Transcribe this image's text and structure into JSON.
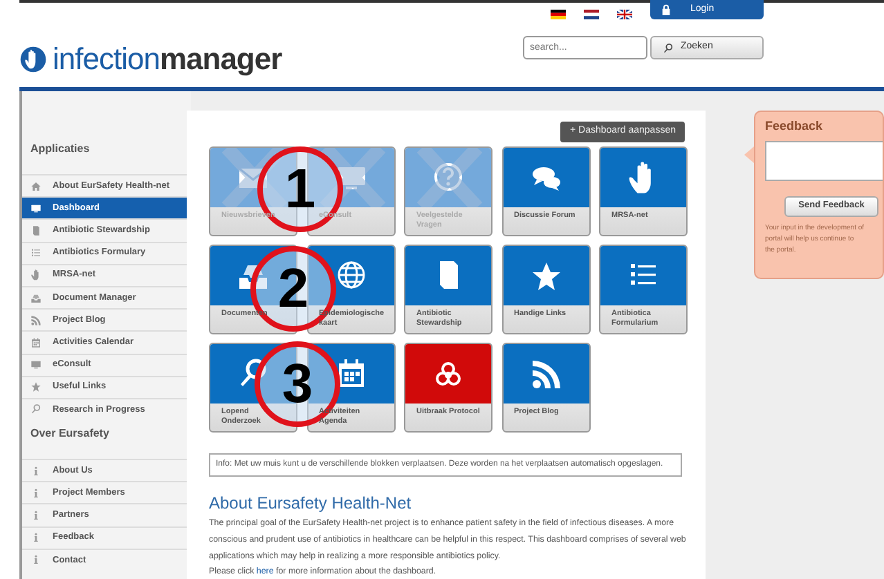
{
  "header": {
    "logo_light": "infection",
    "logo_bold": "manager",
    "login": "Login",
    "search": {
      "placeholder": "search..."
    },
    "search_button": "Zoeken"
  },
  "sidebar": {
    "sections": [
      {
        "title": "Applicaties",
        "items": [
          {
            "label": "About EurSafety Health-net",
            "kind": "home",
            "selected": false
          },
          {
            "label": "Dashboard",
            "kind": "monitor",
            "selected": true
          },
          {
            "label": "Antibiotic Stewardship",
            "kind": "book",
            "selected": false
          },
          {
            "label": "Antibiotics Formulary",
            "kind": "list",
            "selected": false
          },
          {
            "label": "MRSA-net",
            "kind": "hand",
            "selected": false
          },
          {
            "label": "Document Manager",
            "kind": "tray",
            "selected": false
          },
          {
            "label": "Project Blog",
            "kind": "rss",
            "selected": false
          },
          {
            "label": "Activities Calendar",
            "kind": "calendar",
            "selected": false
          },
          {
            "label": "eConsult",
            "kind": "monitor",
            "selected": false
          },
          {
            "label": "Useful Links",
            "kind": "star",
            "selected": false
          },
          {
            "label": "Research in Progress",
            "kind": "search",
            "selected": false
          }
        ]
      },
      {
        "title": "Over Eursafety",
        "items": [
          {
            "label": "About Us",
            "kind": "info",
            "selected": false
          },
          {
            "label": "Project Members",
            "kind": "info",
            "selected": false
          },
          {
            "label": "Partners",
            "kind": "info",
            "selected": false
          },
          {
            "label": "Feedback",
            "kind": "info",
            "selected": false
          },
          {
            "label": "Contact",
            "kind": "info",
            "selected": false
          }
        ]
      }
    ]
  },
  "dashboard": {
    "customize_icon": "+",
    "customize_button": "Dashboard aanpassen",
    "tiles": [
      {
        "label": "Nieuwsbrieven",
        "kind": "mail",
        "color": "#74a9db",
        "disabled": true
      },
      {
        "label": "eConsult",
        "kind": "monitor",
        "color": "#74a9db",
        "disabled": true
      },
      {
        "label": "Veelgestelde Vragen",
        "kind": "question",
        "color": "#74a9db",
        "disabled": true
      },
      {
        "label": "Discussie Forum",
        "kind": "chat",
        "color": "#0b6fc0",
        "disabled": false
      },
      {
        "label": "MRSA-net",
        "kind": "hand",
        "color": "#0b6fc0",
        "disabled": false
      },
      {
        "label": "Documenten",
        "kind": "tray",
        "color": "#0b6fc0",
        "disabled": false
      },
      {
        "label": "Epidemiologische kaart",
        "kind": "globe",
        "color": "#0b6fc0",
        "disabled": false
      },
      {
        "label": "Antibiotic Stewardship",
        "kind": "book",
        "color": "#0b6fc0",
        "disabled": false
      },
      {
        "label": "Handige Links",
        "kind": "star",
        "color": "#0b6fc0",
        "disabled": false
      },
      {
        "label": "Antibiotica Formularium",
        "kind": "list",
        "color": "#0b6fc0",
        "disabled": false
      },
      {
        "label": "Lopend Onderzoek",
        "kind": "search",
        "color": "#0b6fc0",
        "disabled": false
      },
      {
        "label": "Activiteiten Agenda",
        "kind": "calendar",
        "color": "#0b6fc0",
        "disabled": false
      },
      {
        "label": "Uitbraak Protocol",
        "kind": "biohazard",
        "color": "#d10a0a",
        "disabled": false
      },
      {
        "label": "Project Blog",
        "kind": "rss",
        "color": "#0b6fc0",
        "disabled": false
      }
    ],
    "annotations": [
      {
        "label": "1"
      },
      {
        "label": "2"
      },
      {
        "label": "3"
      }
    ],
    "info": "Info: Met uw muis kunt u de verschillende blokken verplaatsen. Deze worden na het verplaatsen automatisch opgeslagen.",
    "heading": "About Eursafety Health-Net",
    "paragraph": "The principal goal of the EurSafety Health-net project is to enhance patient safety in the field of infectious diseases. A more conscious and prudent use of antibiotics in healthcare can be helpful in this respect. This dashboard comprises of several web applications which may help in realizing a more responsible antibiotics policy.",
    "more": {
      "before": "Please click ",
      "link": "here",
      "after": " for more information about the dashboard."
    }
  },
  "feedback": {
    "title": "Feedback",
    "button": "Send Feedback",
    "note_lines": [
      "Your input in the development of",
      "portal will help us continue to",
      "the portal."
    ]
  }
}
